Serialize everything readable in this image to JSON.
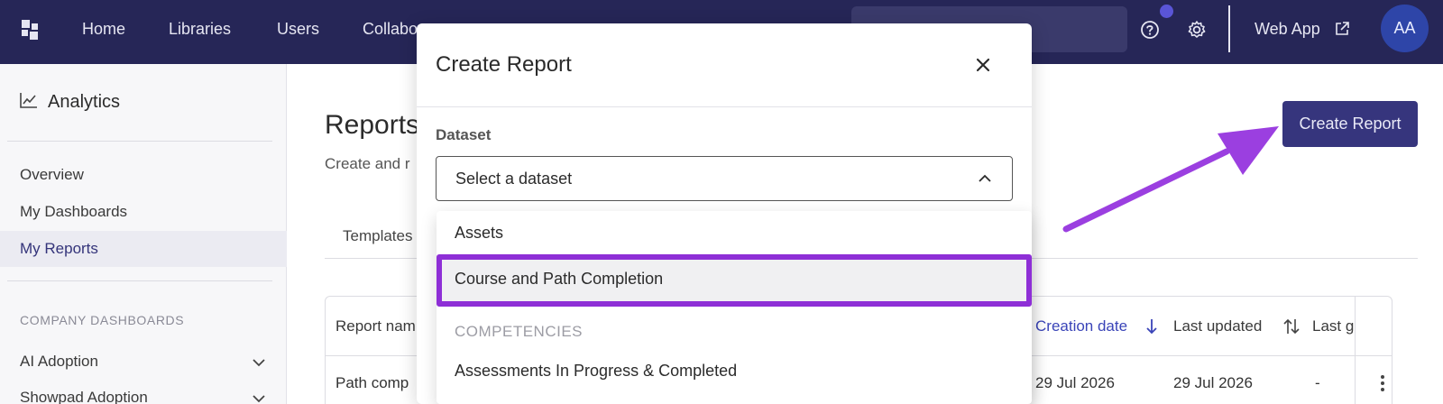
{
  "nav": {
    "links": [
      "Home",
      "Libraries",
      "Users",
      "Collabo"
    ],
    "webapp_label": "Web App",
    "avatar_initials": "AA",
    "icons": [
      "logo-icon",
      "help-icon",
      "settings-icon",
      "external-link-icon"
    ]
  },
  "sidebar": {
    "title": "Analytics",
    "items": [
      {
        "label": "Overview"
      },
      {
        "label": "My Dashboards"
      },
      {
        "label": "My Reports",
        "active": true
      }
    ],
    "section_label": "COMPANY DASHBOARDS",
    "collapsibles": [
      {
        "label": "AI Adoption"
      },
      {
        "label": "Showpad Adoption"
      }
    ]
  },
  "main": {
    "title": "Reports",
    "subtitle": "Create and r",
    "tab": "Templates",
    "create_button": "Create Report",
    "table": {
      "headers": [
        "Report nam",
        "Creation date",
        "Last updated",
        "Last g"
      ],
      "row": {
        "name": "Path comp",
        "created": "29 Jul 2026",
        "updated": "29 Jul 2026",
        "last": "-"
      }
    }
  },
  "modal": {
    "title": "Create Report",
    "dataset_label": "Dataset",
    "select_placeholder": "Select a dataset",
    "options": [
      {
        "label": "Assets"
      },
      {
        "label": "Course and Path Completion",
        "highlighted": true
      }
    ],
    "group_label": "COMPETENCIES",
    "group_options": [
      {
        "label": "Assessments In Progress & Completed"
      }
    ]
  },
  "colors": {
    "nav_bg": "#262657",
    "primary": "#36357d",
    "highlight": "#8e2fd6",
    "arrow": "#9b3fe0",
    "sort_active": "#3a44b8"
  }
}
